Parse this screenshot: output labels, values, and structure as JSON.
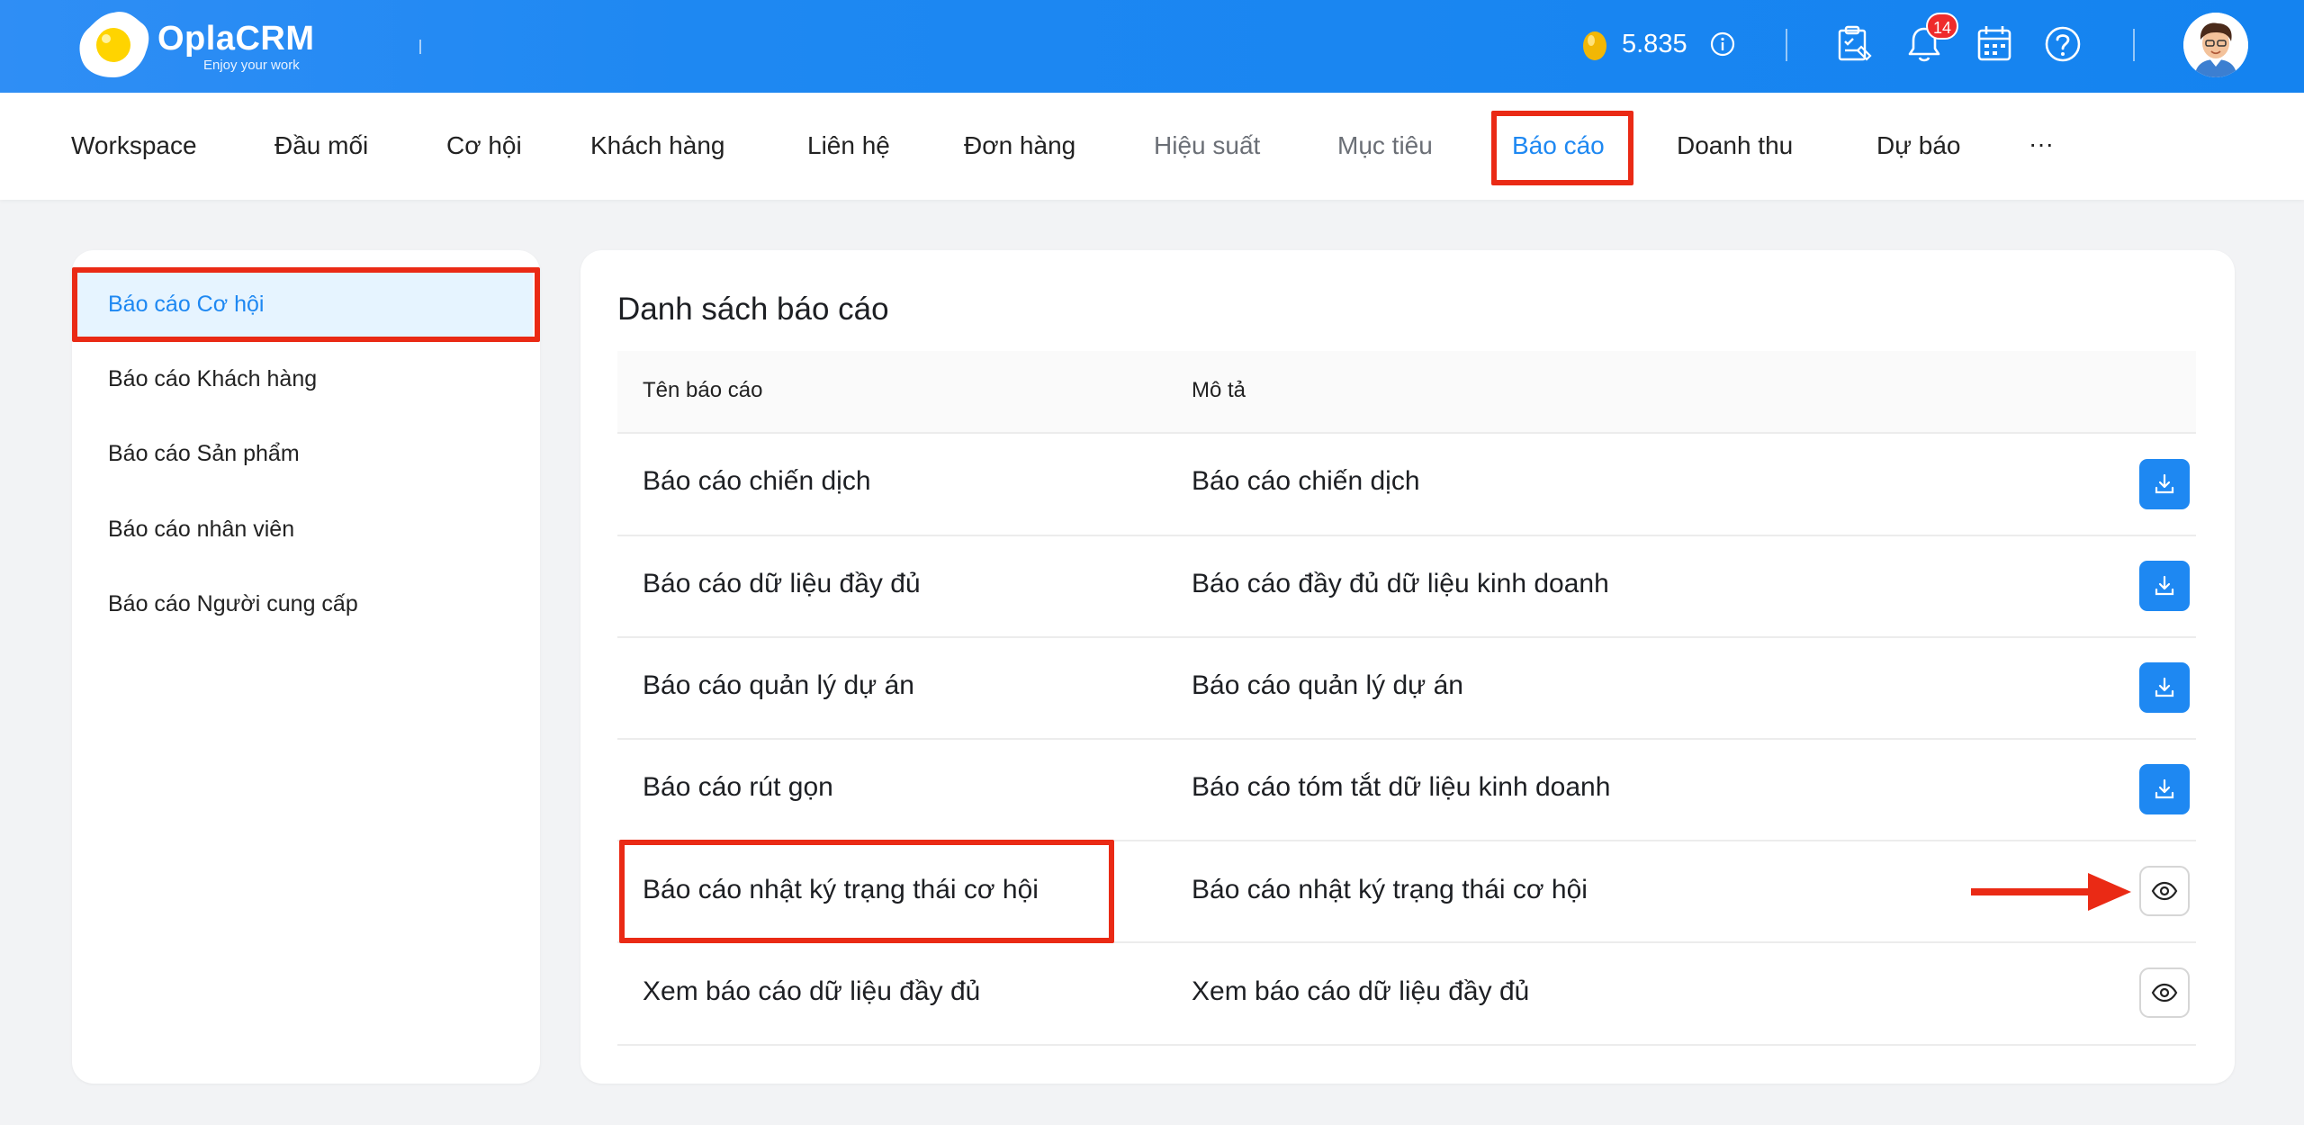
{
  "header": {
    "brand": "OplaCRM",
    "tagline": "Enjoy your work",
    "coins": "5.835",
    "notification_count": "14"
  },
  "nav": {
    "items": [
      {
        "label": "Workspace"
      },
      {
        "label": "Đầu mối"
      },
      {
        "label": "Cơ hội"
      },
      {
        "label": "Khách hàng"
      },
      {
        "label": "Liên hệ"
      },
      {
        "label": "Đơn hàng"
      },
      {
        "label": "Hiệu suất"
      },
      {
        "label": "Mục tiêu"
      },
      {
        "label": "Báo cáo"
      },
      {
        "label": "Doanh thu"
      },
      {
        "label": "Dự báo"
      },
      {
        "label": "···"
      }
    ]
  },
  "sidebar": {
    "items": [
      {
        "label": "Báo cáo Cơ hội"
      },
      {
        "label": "Báo cáo Khách hàng"
      },
      {
        "label": "Báo cáo Sản phẩm"
      },
      {
        "label": "Báo cáo nhân viên"
      },
      {
        "label": "Báo cáo Người cung cấp"
      }
    ]
  },
  "main": {
    "title": "Danh sách báo cáo",
    "columns": [
      "Tên báo cáo",
      "Mô tả"
    ],
    "rows": [
      {
        "name": "Báo cáo chiến dịch",
        "description": "Báo cáo chiến dịch",
        "action": "download"
      },
      {
        "name": "Báo cáo dữ liệu đầy đủ",
        "description": "Báo cáo đầy đủ dữ liệu kinh doanh",
        "action": "download"
      },
      {
        "name": "Báo cáo quản lý dự án",
        "description": "Báo cáo quản lý dự án",
        "action": "download"
      },
      {
        "name": "Báo cáo rút gọn",
        "description": "Báo cáo tóm tắt dữ liệu kinh doanh",
        "action": "download"
      },
      {
        "name": "Báo cáo nhật ký trạng thái cơ hội",
        "description": "Báo cáo nhật ký trạng thái cơ hội",
        "action": "view"
      },
      {
        "name": "Xem báo cáo dữ liệu đầy đủ",
        "description": "Xem báo cáo dữ liệu đầy đủ",
        "action": "view"
      }
    ]
  },
  "colors": {
    "brand_blue": "#1e88f2",
    "highlight_red": "#ea2a15",
    "sidebar_active_bg": "#e6f4ff"
  },
  "icons": {
    "download": "download-icon",
    "view": "eye-icon",
    "bell": "bell-icon",
    "calendar": "calendar-icon",
    "help": "help-circle-icon",
    "tasks": "task-board-icon",
    "info": "info-icon",
    "coin": "golden-egg-icon"
  }
}
